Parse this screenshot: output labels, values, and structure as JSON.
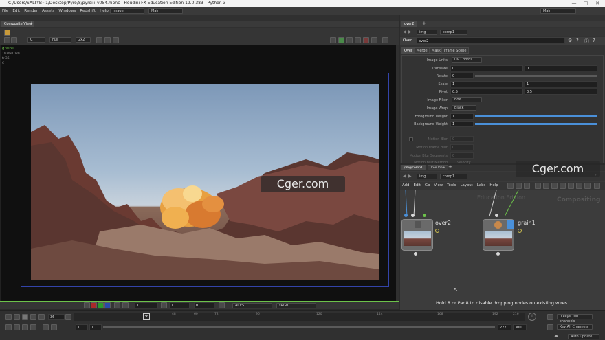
{
  "window": {
    "title": "C:/Users/SALTYB~1/Desktop/Pyro/8/pyroiii_v054.hipnc - Houdini FX Education Edition 19.0.383 - Python 3"
  },
  "menubar": {
    "items": [
      "File",
      "Edit",
      "Render",
      "Assets",
      "Windows",
      "Redshift",
      "Help"
    ],
    "desktop_combo": "Image",
    "main_combo": "Main",
    "right_main_combo": "Main"
  },
  "viewer": {
    "tab": "Composite View",
    "channel": "C",
    "resolution": "Full",
    "tiles": "2x2",
    "info": {
      "name": "grain1",
      "res": "1920x1080",
      "frame": "fr 36",
      "chan": "C"
    },
    "bottom": {
      "field1": "1",
      "field2": "1",
      "field3": "0",
      "colorspace": "ACES",
      "display": "sRGB"
    }
  },
  "params": {
    "pane_tab": "over2",
    "path": [
      "img",
      "comp1"
    ],
    "node_type": "Over",
    "node_name": "over2",
    "tabs": [
      "Over",
      "Merge",
      "Mask",
      "Frame Scope"
    ],
    "rows": [
      {
        "label": "Image Units",
        "value": "UV Coords"
      },
      {
        "label": "Translate",
        "v1": "0",
        "v2": "0"
      },
      {
        "label": "Rotate",
        "v1": "0"
      },
      {
        "label": "Scale",
        "v1": "1",
        "v2": "1"
      },
      {
        "label": "Pivot",
        "v1": "0.5",
        "v2": "0.5"
      },
      {
        "label": "Image Filter",
        "value": "Box"
      },
      {
        "label": "Image Wrap",
        "value": "Black"
      },
      {
        "label": "Foreground Weight",
        "v1": "1"
      },
      {
        "label": "Background Weight",
        "v1": "1"
      }
    ],
    "disabled_rows": [
      {
        "label": "Motion Blur",
        "v1": "0"
      },
      {
        "label": "Motion Frame Blur",
        "v1": "0"
      },
      {
        "label": "Motion Blur Segments",
        "v1": "0"
      },
      {
        "label": "Motion Blur Method",
        "value": "Velocity"
      }
    ]
  },
  "network": {
    "tabs": [
      "/img/comp1",
      "Tree View"
    ],
    "path": [
      "img",
      "comp1"
    ],
    "menu": [
      "Add",
      "Edit",
      "Go",
      "View",
      "Tools",
      "Layout",
      "Labs",
      "Help"
    ],
    "watermark1": "Education Edition",
    "watermark2": "Compositing",
    "nodes": [
      {
        "name": "over2"
      },
      {
        "name": "grain1"
      }
    ],
    "hint": "Hold 8 or Pad8 to disable dropping nodes on existing wires."
  },
  "watermarks": {
    "left": "Cger.com",
    "right": "Cger.com"
  },
  "timeline": {
    "frame": "36",
    "ticks": [
      "36",
      "48",
      "60",
      "72",
      "96",
      "120",
      "144",
      "168",
      "192",
      "216"
    ],
    "start": "1",
    "start2": "1",
    "end": "222",
    "end2": "300",
    "keys": "0 keys, 0/0 channels",
    "key_all": "Key All Channels",
    "auto_update": "Auto Update"
  },
  "colors": {
    "accent_green": "#6cc24a",
    "accent_blue": "#4a90d9",
    "frame_border": "#3344aa"
  }
}
